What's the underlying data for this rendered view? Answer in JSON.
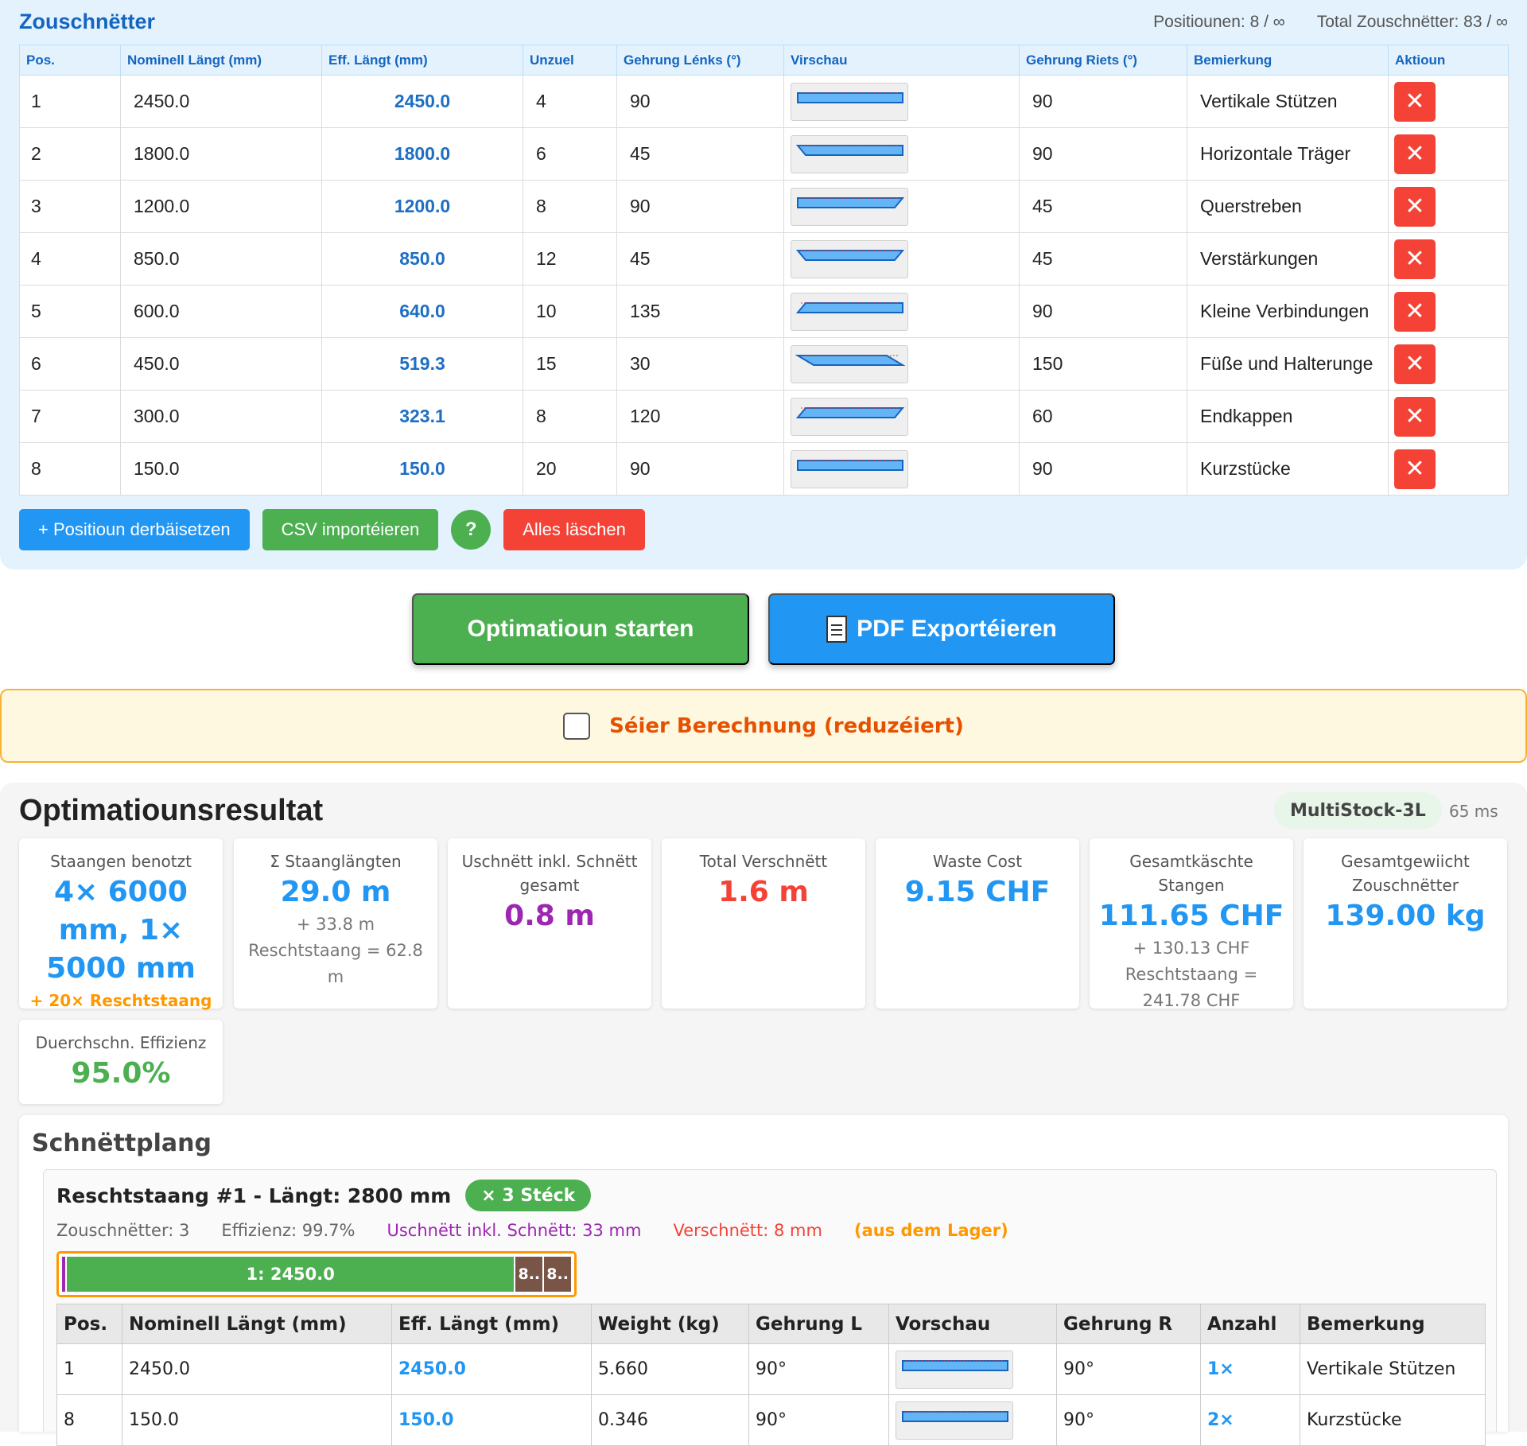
{
  "cut_list": {
    "title": "Zouschnëtter",
    "positions_stat": "Positiounen: 8 / ∞",
    "total_stat": "Total Zouschnëtter: 83 / ∞",
    "columns": [
      "Pos.",
      "Nominell Längt (mm)",
      "Eff. Längt (mm)",
      "Unzuel",
      "Gehrung Lénks (°)",
      "Virschau",
      "Gehrung Riets (°)",
      "Bemierkung",
      "Aktioun"
    ],
    "rows": [
      {
        "pos": "1",
        "nominal": "2450.0",
        "eff": "2450.0",
        "qty": "4",
        "left": "90",
        "right": "90",
        "note": "Vertikale Stützen"
      },
      {
        "pos": "2",
        "nominal": "1800.0",
        "eff": "1800.0",
        "qty": "6",
        "left": "45",
        "right": "90",
        "note": "Horizontale Träger"
      },
      {
        "pos": "3",
        "nominal": "1200.0",
        "eff": "1200.0",
        "qty": "8",
        "left": "90",
        "right": "45",
        "note": "Querstreben"
      },
      {
        "pos": "4",
        "nominal": "850.0",
        "eff": "850.0",
        "qty": "12",
        "left": "45",
        "right": "45",
        "note": "Verstärkungen"
      },
      {
        "pos": "5",
        "nominal": "600.0",
        "eff": "640.0",
        "qty": "10",
        "left": "135",
        "right": "90",
        "note": "Kleine Verbindungen"
      },
      {
        "pos": "6",
        "nominal": "450.0",
        "eff": "519.3",
        "qty": "15",
        "left": "30",
        "right": "150",
        "note": "Füße und Halterunge"
      },
      {
        "pos": "7",
        "nominal": "300.0",
        "eff": "323.1",
        "qty": "8",
        "left": "120",
        "right": "60",
        "note": "Endkappen"
      },
      {
        "pos": "8",
        "nominal": "150.0",
        "eff": "150.0",
        "qty": "20",
        "left": "90",
        "right": "90",
        "note": "Kurzstücke"
      }
    ],
    "delete_icon": "close-icon",
    "buttons": {
      "add": "+ Positioun derbäisetzen",
      "csv": "CSV importéieren",
      "help": "?",
      "clear": "Alles läschen"
    }
  },
  "actions": {
    "start": "Optimatioun starten",
    "pdf": "PDF Exportéieren",
    "pdf_icon": "document-icon"
  },
  "fast_calc": {
    "label": "Séier Berechnung (reduzéiert)",
    "checked": false
  },
  "results": {
    "title": "Optimatiounsresultat",
    "algorithm": "MultiStock-3L",
    "time": "65 ms",
    "cards": {
      "bars_used": {
        "label": "Staangen benotzt",
        "value": "4× 6000 mm, 1× 5000 mm",
        "extra": "+ 20× Reschtstaang"
      },
      "sum_lengths": {
        "label": "Σ Staanglängten",
        "value": "29.0 m",
        "sub": "+ 33.8 m Reschtstaang = 62.8 m"
      },
      "kerf": {
        "label": "Uschnëtt inkl. Schnëtt gesamt",
        "value": "0.8 m"
      },
      "waste": {
        "label": "Total Verschnëtt",
        "value": "1.6 m"
      },
      "waste_cost": {
        "label": "Waste Cost",
        "value": "9.15 CHF"
      },
      "total_cost": {
        "label": "Gesamtkäschte Stangen",
        "value": "111.65 CHF",
        "sub": "+ 130.13 CHF Reschtstaang = 241.78 CHF"
      },
      "weight": {
        "label": "Gesamtgewiicht Zouschnëtter",
        "value": "139.00 kg"
      },
      "efficiency": {
        "label": "Duerchschn. Effizienz",
        "value": "95.0%"
      }
    },
    "plan": {
      "title": "Schnëttplang",
      "stock": {
        "title": "Reschtstaang #1 - Längt: 2800 mm",
        "count": "× 3 Stéck",
        "pieces": "Zouschnëtter: 3",
        "efficiency": "Effizienz: 99.7%",
        "kerf": "Uschnëtt inkl. Schnëtt: 33 mm",
        "waste": "Verschnëtt: 8 mm",
        "source": "(aus dem Lager)",
        "bar_segments": [
          "1: 2450.0",
          "8..",
          "8.."
        ],
        "columns": [
          "Pos.",
          "Nominell Längt (mm)",
          "Eff. Längt (mm)",
          "Weight (kg)",
          "Gehrung L",
          "Vorschau",
          "Gehrung R",
          "Anzahl",
          "Bemerkung"
        ],
        "rows": [
          {
            "pos": "1",
            "nominal": "2450.0",
            "eff": "2450.0",
            "weight": "5.660",
            "left": "90°",
            "right": "90°",
            "count": "1×",
            "note": "Vertikale Stützen"
          },
          {
            "pos": "8",
            "nominal": "150.0",
            "eff": "150.0",
            "weight": "0.346",
            "left": "90°",
            "right": "90°",
            "count": "2×",
            "note": "Kurzstücke"
          }
        ]
      }
    }
  },
  "colors": {
    "primary_blue": "#2196f3",
    "title_blue": "#1565c0",
    "green": "#4caf50",
    "red": "#f44336",
    "purple": "#9c27b0",
    "orange": "#ff9800"
  }
}
